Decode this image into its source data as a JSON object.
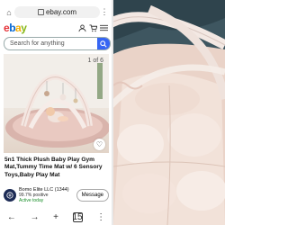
{
  "browser": {
    "url": "ebay.com",
    "tab_count": "15"
  },
  "header": {
    "logo": [
      "e",
      "b",
      "a",
      "y"
    ]
  },
  "search": {
    "placeholder": "Search for anything"
  },
  "listing": {
    "image_counter": "1 of 6",
    "title": "5n1 Thick Plush Baby Play Gym Mat,Tummy Time Mat w/ 6 Sensory Toys,Baby Play Mat",
    "seller_name": "Bomo Elite LLC (1344)",
    "seller_feedback": "99.7% positive",
    "seller_status": "Active today",
    "message_button": "Message"
  },
  "colors": {
    "ebay_blue": "#3665f3",
    "active_green": "#1b8f2b"
  }
}
